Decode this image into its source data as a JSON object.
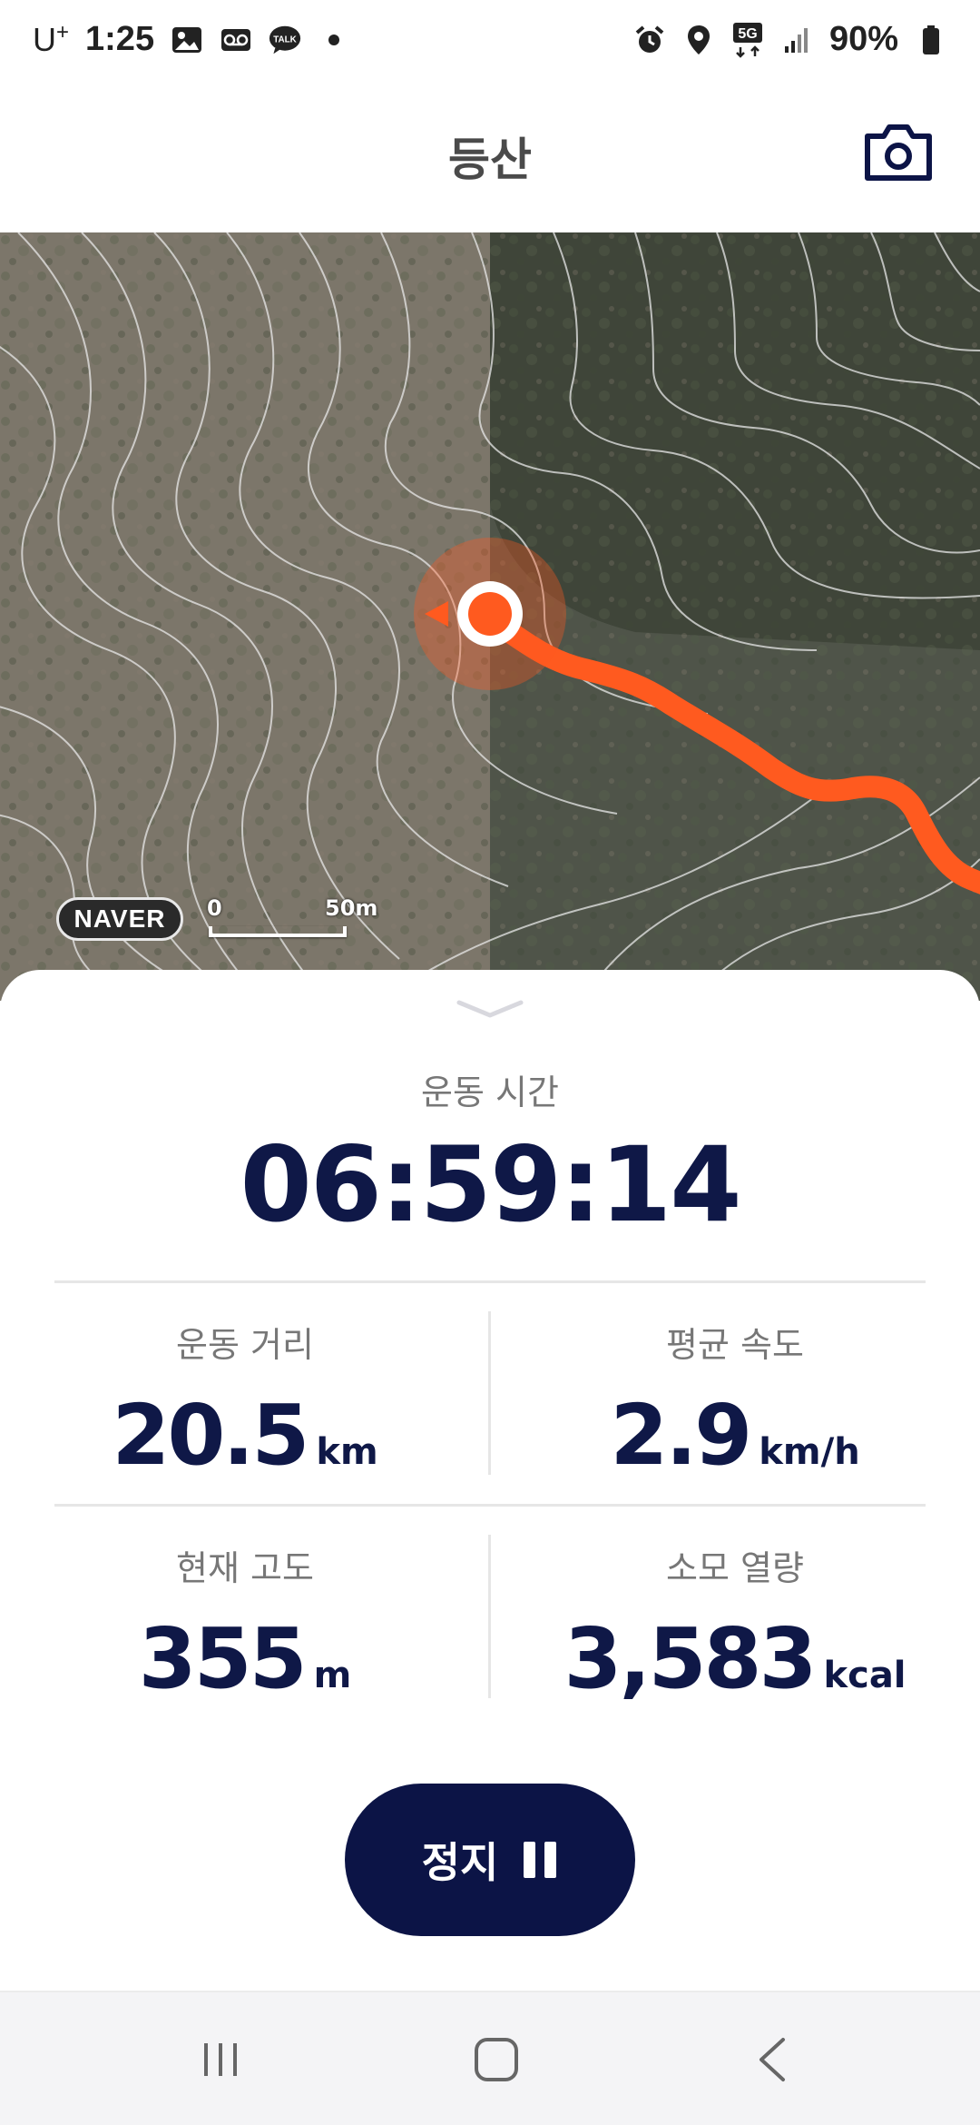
{
  "status_bar": {
    "carrier": "U",
    "carrier_sup": "+",
    "time": "1:25",
    "network": "5G",
    "battery": "90%",
    "left_icons": [
      "gallery-icon",
      "voicemail-icon",
      "kakaotalk-icon",
      "dot-icon"
    ],
    "right_icons": [
      "alarm-icon",
      "location-icon",
      "5g-icon",
      "signal-icon",
      "battery-icon"
    ]
  },
  "header": {
    "title": "등산",
    "camera_icon": "camera-icon"
  },
  "map": {
    "provider": "NAVER",
    "scale_start": "0",
    "scale_end": "50m",
    "route_color": "#ff5a1f",
    "marker_color": "#ff5a1f"
  },
  "stats": {
    "time_label": "운동 시간",
    "time_value": "06:59:14",
    "distance": {
      "label": "운동 거리",
      "value": "20.5",
      "unit": "km"
    },
    "avg_speed": {
      "label": "평균 속도",
      "value": "2.9",
      "unit": "km/h"
    },
    "altitude": {
      "label": "현재 고도",
      "value": "355",
      "unit": "m"
    },
    "calories": {
      "label": "소모 열량",
      "value": "3,583",
      "unit": "kcal"
    }
  },
  "controls": {
    "stop_label": "정지",
    "stop_icon": "pause-icon",
    "button_color": "#0c1446"
  },
  "nav_bar": {
    "buttons": [
      "recent-apps-icon",
      "home-icon",
      "back-icon"
    ]
  }
}
